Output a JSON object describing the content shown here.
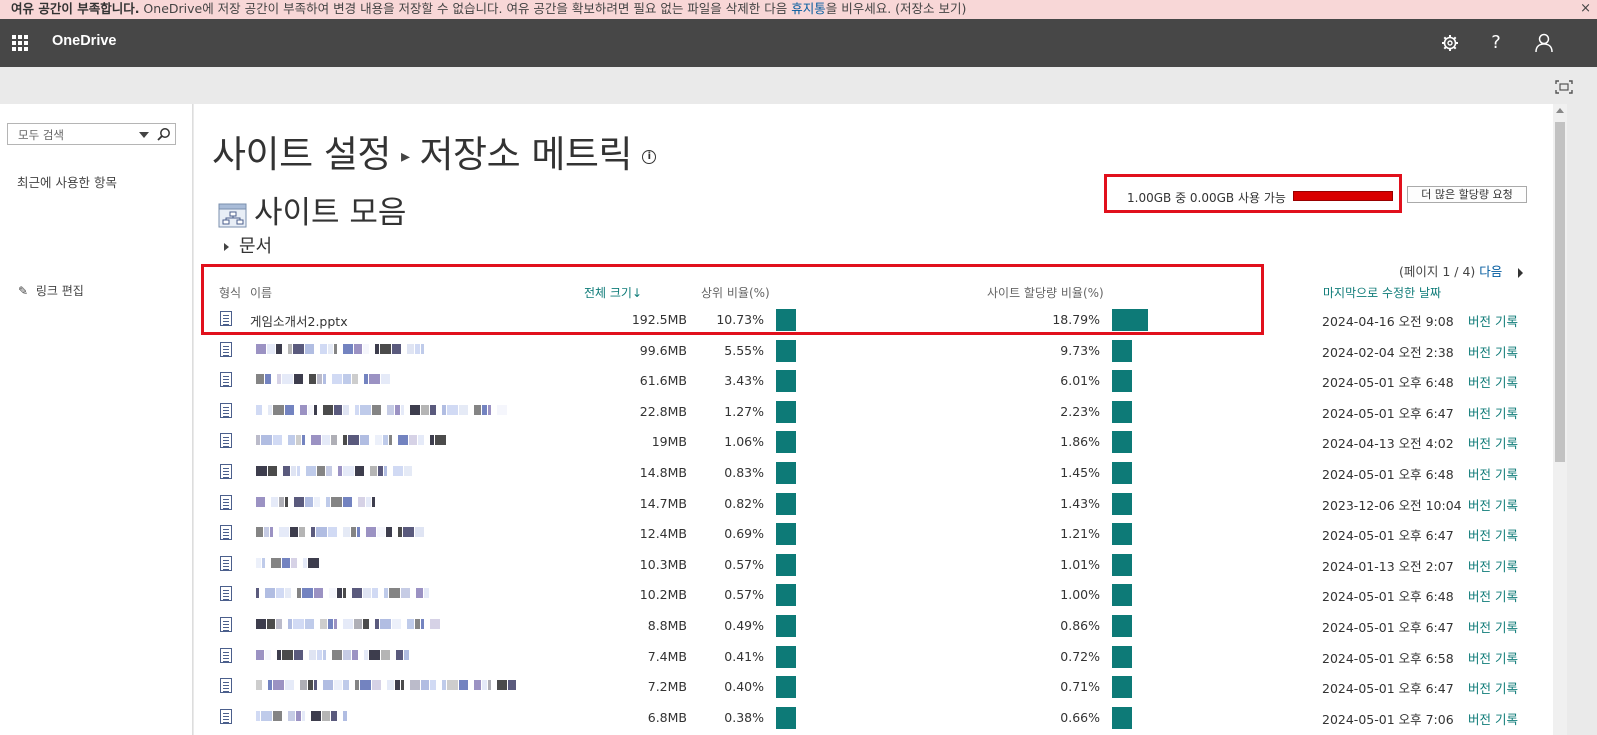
{
  "warning": {
    "bold": "여유 공간이 부족합니다.",
    "message": " OneDrive에 저장 공간이 부족하여 변경 내용을 저장할 수 없습니다. 여유 공간을 확보하려면 필요 없는 파일을 삭제한 다음 ",
    "link": "휴지통",
    "after": "을 비우세요. (저장소 보기)",
    "close": "×"
  },
  "suitebar": {
    "brand": "OneDrive"
  },
  "leftnav": {
    "search_placeholder": "모두 검색",
    "recent": "최근에 사용한 항목",
    "edit_links": "링크 편집"
  },
  "page": {
    "title_part1": "사이트 설정",
    "title_part2": "저장소 메트릭",
    "info": "i",
    "subtitle": "사이트 모음",
    "node": "문서"
  },
  "quota": {
    "text": "1.00GB 중 0.00GB 사용 가능",
    "request_button": "더 많은 할당량 요청",
    "accent": "#d90000"
  },
  "pager": {
    "text": "(페이지 1 / 4)",
    "next": "다음"
  },
  "columns": {
    "type": "형식",
    "name": "이름",
    "total_size": "전체 크기↓",
    "parent_pct": "상위 비율(%)",
    "site_quota_pct": "사이트 할당량 비율(%)",
    "last_modified": "마지막으로 수정한 날짜"
  },
  "rows": [
    {
      "name": "게임소개서2.pptx",
      "size": "192.5MB",
      "parent_pct": "10.73%",
      "quota_pct": "18.79%",
      "quota_value": 18.79,
      "date": "2024-04-16 오전 9:08",
      "version": "버전 기록"
    },
    {
      "name": "",
      "size": "99.6MB",
      "parent_pct": "5.55%",
      "quota_pct": "9.73%",
      "quota_value": 9.73,
      "date": "2024-02-04 오전 2:38",
      "version": "버전 기록"
    },
    {
      "name": "",
      "size": "61.6MB",
      "parent_pct": "3.43%",
      "quota_pct": "6.01%",
      "quota_value": 6.01,
      "date": "2024-05-01 오후 6:48",
      "version": "버전 기록"
    },
    {
      "name": "",
      "size": "22.8MB",
      "parent_pct": "1.27%",
      "quota_pct": "2.23%",
      "quota_value": 2.23,
      "date": "2024-05-01 오후 6:47",
      "version": "버전 기록"
    },
    {
      "name": "",
      "size": "19MB",
      "parent_pct": "1.06%",
      "quota_pct": "1.86%",
      "quota_value": 1.86,
      "date": "2024-04-13 오전 4:02",
      "version": "버전 기록"
    },
    {
      "name": "",
      "size": "14.8MB",
      "parent_pct": "0.83%",
      "quota_pct": "1.45%",
      "quota_value": 1.45,
      "date": "2024-05-01 오후 6:48",
      "version": "버전 기록"
    },
    {
      "name": "",
      "size": "14.7MB",
      "parent_pct": "0.82%",
      "quota_pct": "1.43%",
      "quota_value": 1.43,
      "date": "2023-12-06 오전 10:04",
      "version": "버전 기록"
    },
    {
      "name": "",
      "size": "12.4MB",
      "parent_pct": "0.69%",
      "quota_pct": "1.21%",
      "quota_value": 1.21,
      "date": "2024-05-01 오후 6:47",
      "version": "버전 기록"
    },
    {
      "name": "",
      "size": "10.3MB",
      "parent_pct": "0.57%",
      "quota_pct": "1.01%",
      "quota_value": 1.01,
      "date": "2024-01-13 오전 2:07",
      "version": "버전 기록"
    },
    {
      "name": "",
      "size": "10.2MB",
      "parent_pct": "0.57%",
      "quota_pct": "1.00%",
      "quota_value": 1.0,
      "date": "2024-05-01 오후 6:48",
      "version": "버전 기록"
    },
    {
      "name": "",
      "size": "8.8MB",
      "parent_pct": "0.49%",
      "quota_pct": "0.86%",
      "quota_value": 0.86,
      "date": "2024-05-01 오후 6:47",
      "version": "버전 기록"
    },
    {
      "name": "",
      "size": "7.4MB",
      "parent_pct": "0.41%",
      "quota_pct": "0.72%",
      "quota_value": 0.72,
      "date": "2024-05-01 오후 6:58",
      "version": "버전 기록"
    },
    {
      "name": "",
      "size": "7.2MB",
      "parent_pct": "0.40%",
      "quota_pct": "0.71%",
      "quota_value": 0.71,
      "date": "2024-05-01 오후 6:47",
      "version": "버전 기록"
    },
    {
      "name": "",
      "size": "6.8MB",
      "parent_pct": "0.38%",
      "quota_pct": "0.66%",
      "quota_value": 0.66,
      "date": "2024-05-01 오후 7:06",
      "version": "버전 기록"
    }
  ],
  "colors": {
    "teal": "#0d7a77",
    "highlight": "#e1101c",
    "warning_bg": "#f8d7d7"
  }
}
